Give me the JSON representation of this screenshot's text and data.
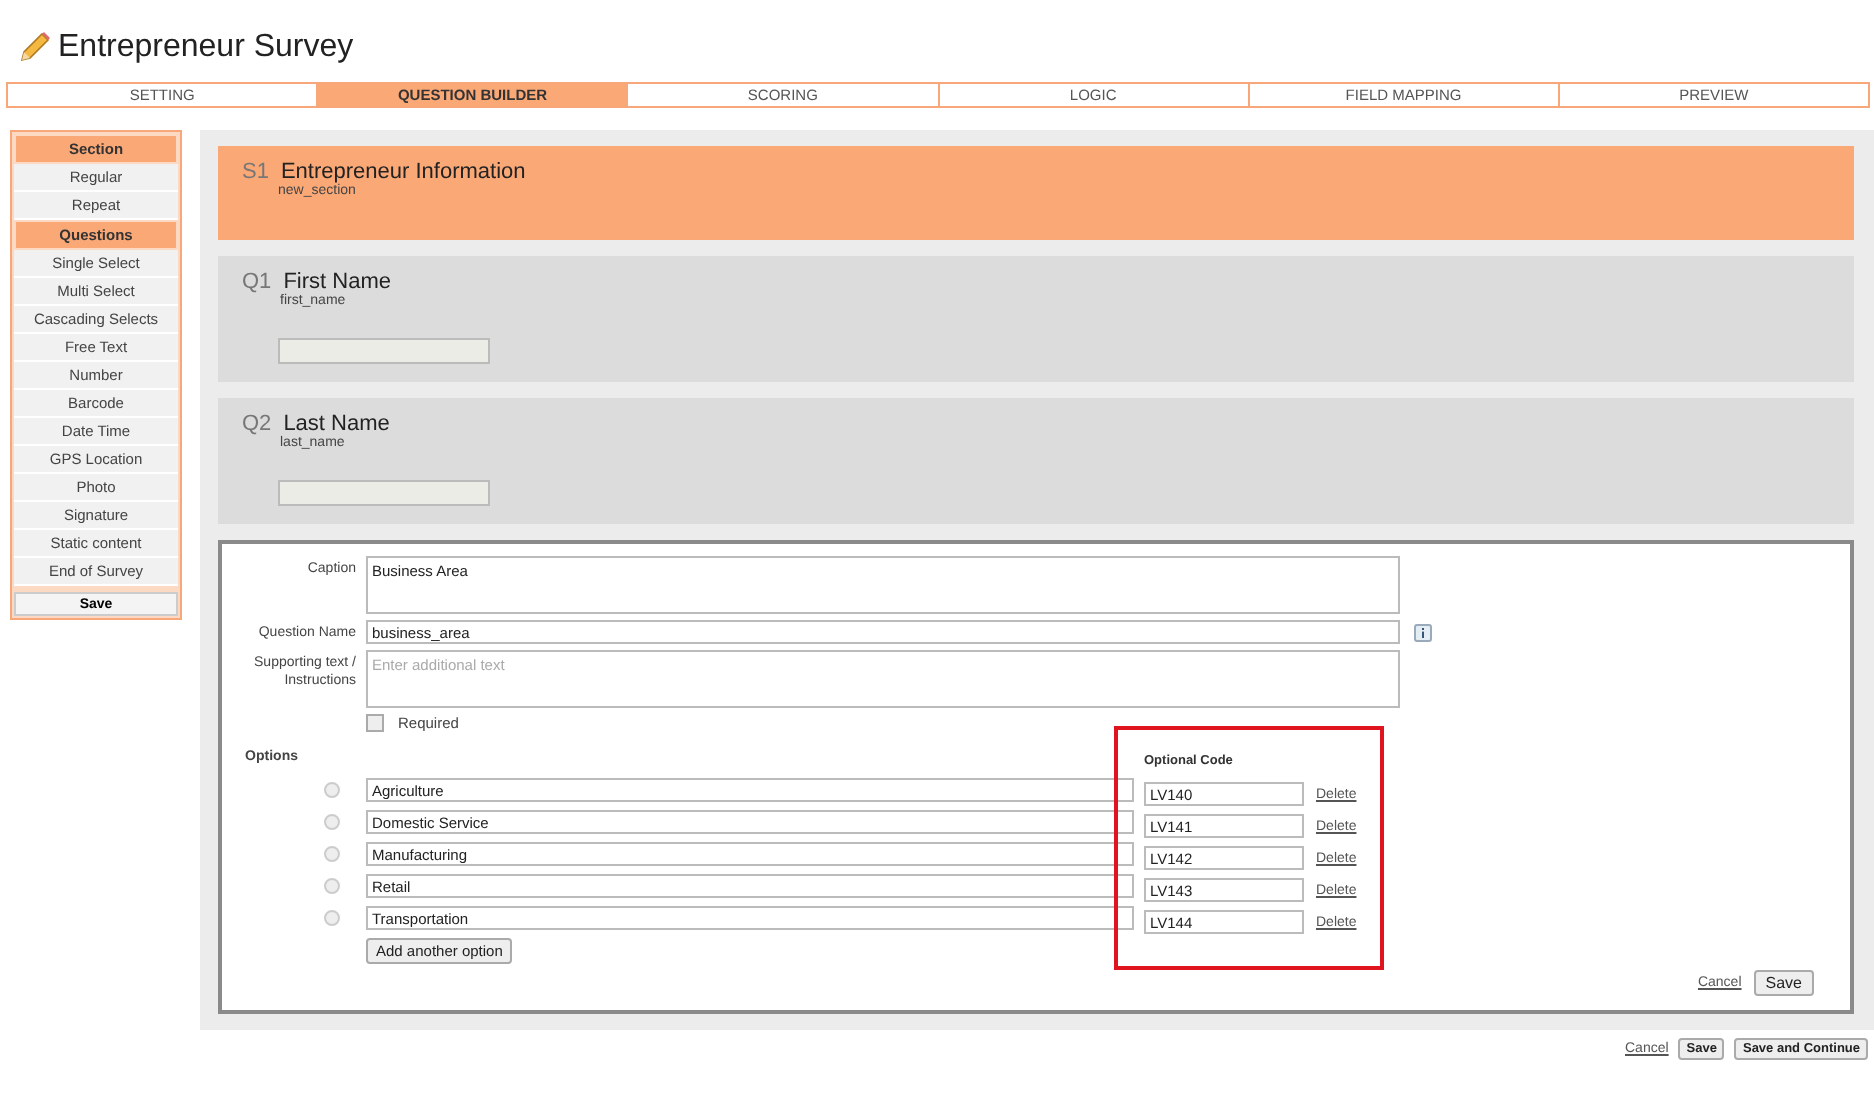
{
  "title": "Entrepreneur Survey",
  "tabs": [
    {
      "label": "SETTING",
      "selected": false
    },
    {
      "label": "QUESTION BUILDER",
      "selected": true
    },
    {
      "label": "SCORING",
      "selected": false
    },
    {
      "label": "LOGIC",
      "selected": false
    },
    {
      "label": "FIELD MAPPING",
      "selected": false
    },
    {
      "label": "PREVIEW",
      "selected": false
    }
  ],
  "sidebar": {
    "groups": [
      {
        "heading": "Section",
        "items": [
          "Regular",
          "Repeat"
        ]
      },
      {
        "heading": "Questions",
        "items": [
          "Single Select",
          "Multi Select",
          "Cascading Selects",
          "Free Text",
          "Number",
          "Barcode",
          "Date Time",
          "GPS Location",
          "Photo",
          "Signature",
          "Static content",
          "End of Survey"
        ]
      }
    ],
    "save_button": "Save"
  },
  "section": {
    "number": "S1",
    "title": "Entrepreneur Information",
    "name": "new_section"
  },
  "questions": [
    {
      "number": "Q1",
      "title": "First Name",
      "name": "first_name"
    },
    {
      "number": "Q2",
      "title": "Last Name",
      "name": "last_name"
    }
  ],
  "editor": {
    "caption_label": "Caption",
    "caption": "Business Area",
    "question_name_label": "Question Name",
    "question_name": "business_area",
    "supporting_label": "Supporting text / Instructions",
    "supporting_placeholder": "Enter additional text",
    "required": {
      "label": "Required",
      "checked": false
    },
    "options_heading": "Options",
    "code_heading": "Optional Code",
    "options": [
      {
        "text": "Agriculture",
        "code": "LV140",
        "selected": false,
        "delete": "Delete"
      },
      {
        "text": "Domestic Service",
        "code": "LV141",
        "selected": false,
        "delete": "Delete"
      },
      {
        "text": "Manufacturing",
        "code": "LV142",
        "selected": false,
        "delete": "Delete"
      },
      {
        "text": "Retail",
        "code": "LV143",
        "selected": false,
        "delete": "Delete"
      },
      {
        "text": "Transportation",
        "code": "LV144",
        "selected": false,
        "delete": "Delete"
      }
    ],
    "add_option": "Add another option",
    "cancel": "Cancel",
    "save": "Save"
  },
  "footer": {
    "cancel": "Cancel",
    "save": "Save",
    "save_continue": "Save and Continue"
  }
}
